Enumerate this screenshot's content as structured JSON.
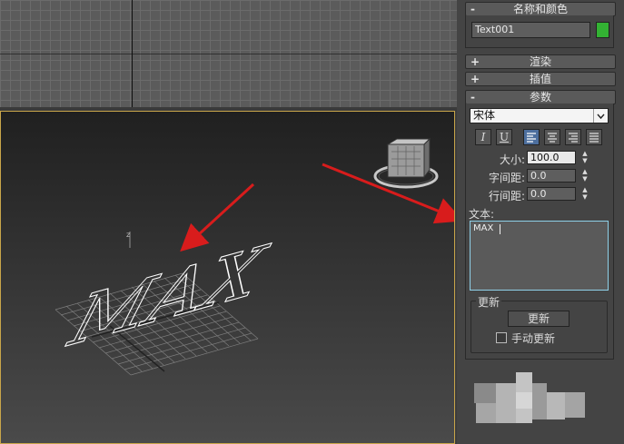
{
  "panel": {
    "name_color": {
      "title": "名称和颜色",
      "sign": "-",
      "object_name": "Text001",
      "object_color": "#33b233"
    },
    "rollout_render": {
      "title": "渲染",
      "sign": "+"
    },
    "rollout_interp": {
      "title": "插值",
      "sign": "+"
    },
    "rollout_params": {
      "title": "参数",
      "sign": "-"
    },
    "font_select": {
      "value": "宋体"
    },
    "style_buttons": {
      "italic": "I",
      "underline": "U"
    },
    "spinners": {
      "size": {
        "label": "大小:",
        "value": "100.0"
      },
      "kerning": {
        "label": "字间距:",
        "value": "0.0"
      },
      "leading": {
        "label": "行间距:",
        "value": "0.0"
      }
    },
    "text_label": "文本:",
    "text_value": "MAX",
    "update_group": {
      "title": "更新",
      "button": "更新",
      "manual_label": "手动更新",
      "manual_checked": false
    }
  },
  "viewport": {
    "text_object": "MAX",
    "axis_label": "z"
  },
  "colors": {
    "arrow": "#d81c1c",
    "viewport_border": "#c9a64a",
    "active_align": "#4d6f9e"
  }
}
